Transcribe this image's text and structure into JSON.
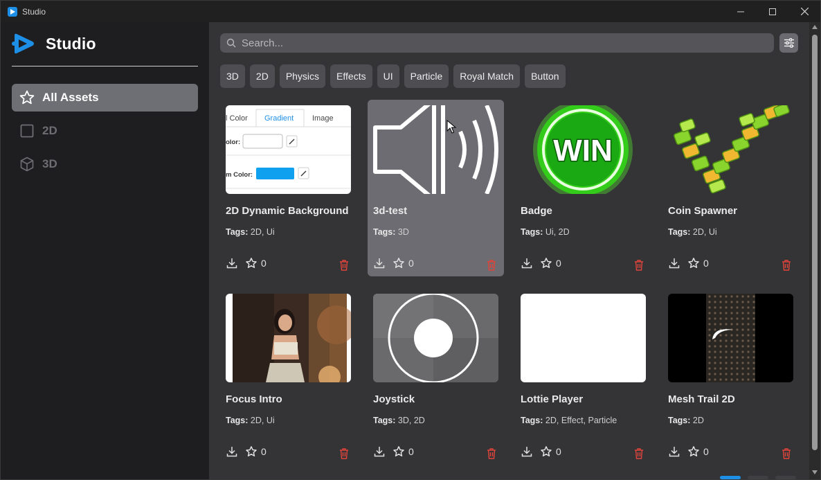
{
  "window": {
    "title": "Studio"
  },
  "sidebar": {
    "brand": "Studio",
    "items": [
      {
        "label": "All Assets",
        "icon": "star-icon",
        "active": true
      },
      {
        "label": "2D",
        "icon": "square-icon",
        "active": false
      },
      {
        "label": "3D",
        "icon": "cube-icon",
        "active": false
      }
    ]
  },
  "search": {
    "placeholder": "Search..."
  },
  "tags": [
    "3D",
    "2D",
    "Physics",
    "Effects",
    "UI",
    "Particle",
    "Royal Match",
    "Button"
  ],
  "tags_prefix": "Tags:",
  "assets": [
    {
      "title": "2D Dynamic Background",
      "tags": "2D, Ui",
      "favorites": "0",
      "preview": {
        "tab1": "l Color",
        "tab2": "Gradient",
        "tab3": "Image",
        "row1": "olor:",
        "row2": "m Color:"
      }
    },
    {
      "title": "3d-test",
      "tags": "3D",
      "favorites": "0"
    },
    {
      "title": "Badge",
      "tags": "Ui, 2D",
      "favorites": "0",
      "preview": {
        "text": "WIN"
      }
    },
    {
      "title": "Coin Spawner",
      "tags": "2D, Ui",
      "favorites": "0"
    },
    {
      "title": "Focus Intro",
      "tags": "2D, Ui",
      "favorites": "0"
    },
    {
      "title": "Joystick",
      "tags": "3D, 2D",
      "favorites": "0"
    },
    {
      "title": "Lottie Player",
      "tags": "2D, Effect, Particle",
      "favorites": "0"
    },
    {
      "title": "Mesh Trail 2D",
      "tags": "2D",
      "favorites": "0"
    }
  ],
  "colors": {
    "accent": "#1e8fe6",
    "delete": "#e0443a",
    "badge_green": "#33cc1a",
    "coin_green": "#8ad42e"
  }
}
